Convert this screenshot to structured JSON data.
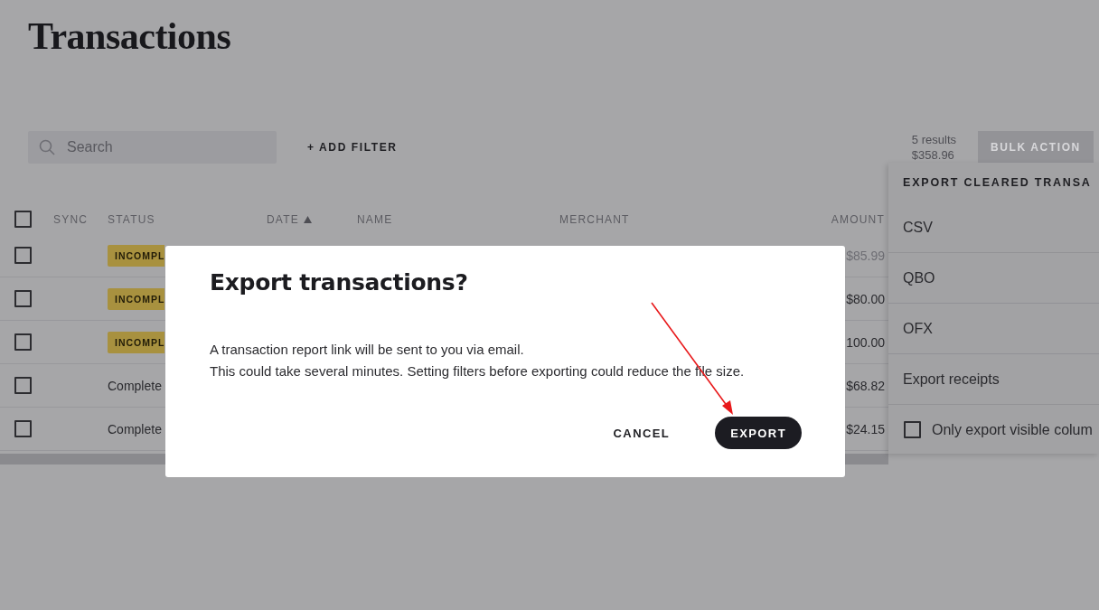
{
  "page": {
    "title": "Transactions"
  },
  "toolbar": {
    "search": {
      "placeholder": "Search"
    },
    "add_filter": "+ ADD FILTER",
    "results": {
      "count": "5 results",
      "total": "$358.96"
    },
    "bulk_action": {
      "label": "BULK ACTION",
      "disabled": true
    }
  },
  "table": {
    "select_all": {
      "checked": false
    },
    "columns": [
      {
        "label": "SYNC",
        "sorted_ascending": false
      },
      {
        "label": "STATUS",
        "sorted_ascending": false
      },
      {
        "label": "DATE",
        "sorted_ascending": true
      },
      {
        "label": "NAME",
        "sorted_ascending": false
      },
      {
        "label": "MERCHANT",
        "sorted_ascending": false
      },
      {
        "label": "AMOUNT",
        "sorted_ascending": false
      }
    ],
    "rows": [
      {
        "checked": false,
        "status": {
          "kind": "badge",
          "label": "INCOMPL"
        },
        "amount": "$85.99",
        "pending": true
      },
      {
        "checked": false,
        "status": {
          "kind": "badge",
          "label": "INCOMPL"
        },
        "amount": "$80.00",
        "pending": false
      },
      {
        "checked": false,
        "status": {
          "kind": "badge",
          "label": "INCOMPL"
        },
        "amount": "100.00",
        "pending": false
      },
      {
        "checked": false,
        "status": {
          "kind": "text",
          "label": "Complete"
        },
        "amount": "$68.82",
        "pending": false
      },
      {
        "checked": false,
        "status": {
          "kind": "text",
          "label": "Complete"
        },
        "amount": "$24.15",
        "pending": false
      }
    ]
  },
  "export_menu": {
    "title": "EXPORT CLEARED TRANSA",
    "items": [
      "CSV",
      "QBO",
      "OFX",
      "Export receipts"
    ],
    "visible_columns": {
      "label": "Only export visible colum",
      "checked": false
    }
  },
  "dialog": {
    "title": "Export transactions?",
    "lines": [
      "A transaction report link will be sent to you via email.",
      "This could take several minutes. Setting filters before exporting could reduce the file size."
    ],
    "buttons": [
      {
        "label": "CANCEL",
        "kind": "text"
      },
      {
        "label": "EXPORT",
        "kind": "primary"
      }
    ]
  }
}
